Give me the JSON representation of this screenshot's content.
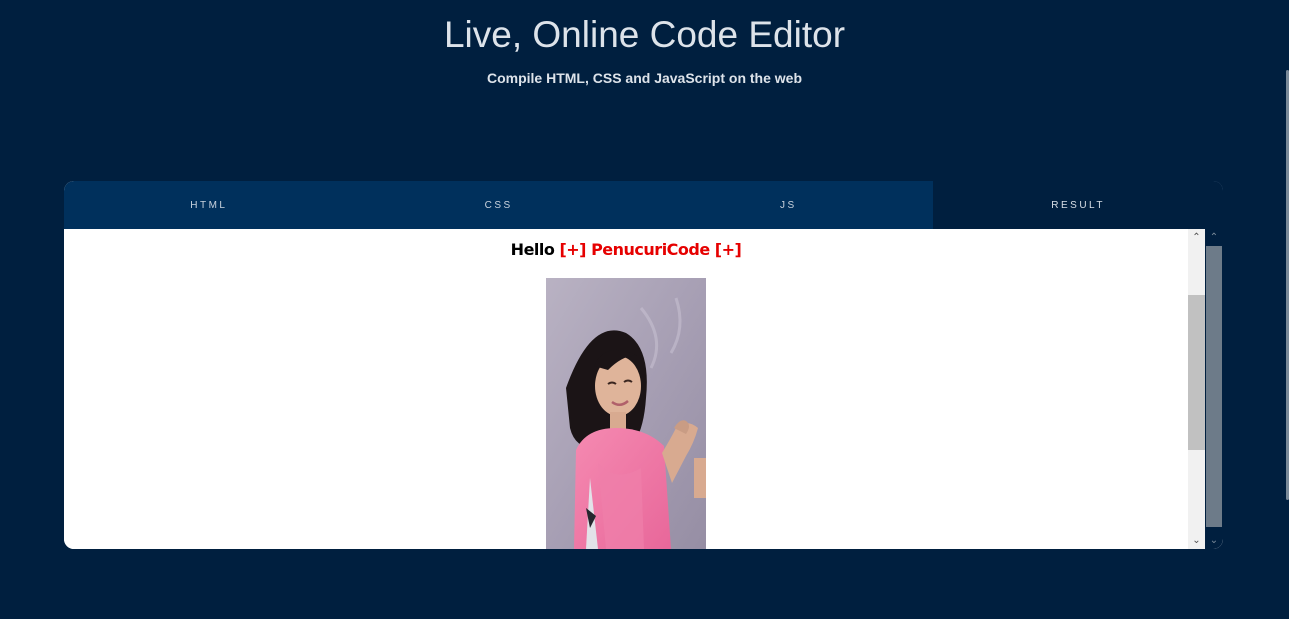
{
  "header": {
    "title": "Live, Online Code Editor",
    "subtitle": "Compile HTML, CSS and JavaScript on the web"
  },
  "tabs": [
    {
      "label": "HTML",
      "active": false
    },
    {
      "label": "CSS",
      "active": false
    },
    {
      "label": "JS",
      "active": false
    },
    {
      "label": "RESULT",
      "active": true
    }
  ],
  "result": {
    "greeting": "Hello",
    "marker_left": "[+]",
    "name": "PenucuriCode",
    "marker_right": "[+]",
    "image_icon": "photo-of-person-dancing-icon"
  },
  "scrollbars": {
    "up_icon": "chevron-up-icon",
    "down_icon": "chevron-down-icon"
  },
  "colors": {
    "background": "#001f3f",
    "tab_bar": "#00305c",
    "active_tab": "#001f3f",
    "accent_red": "#e60000",
    "title_text": "#dde3ea"
  }
}
